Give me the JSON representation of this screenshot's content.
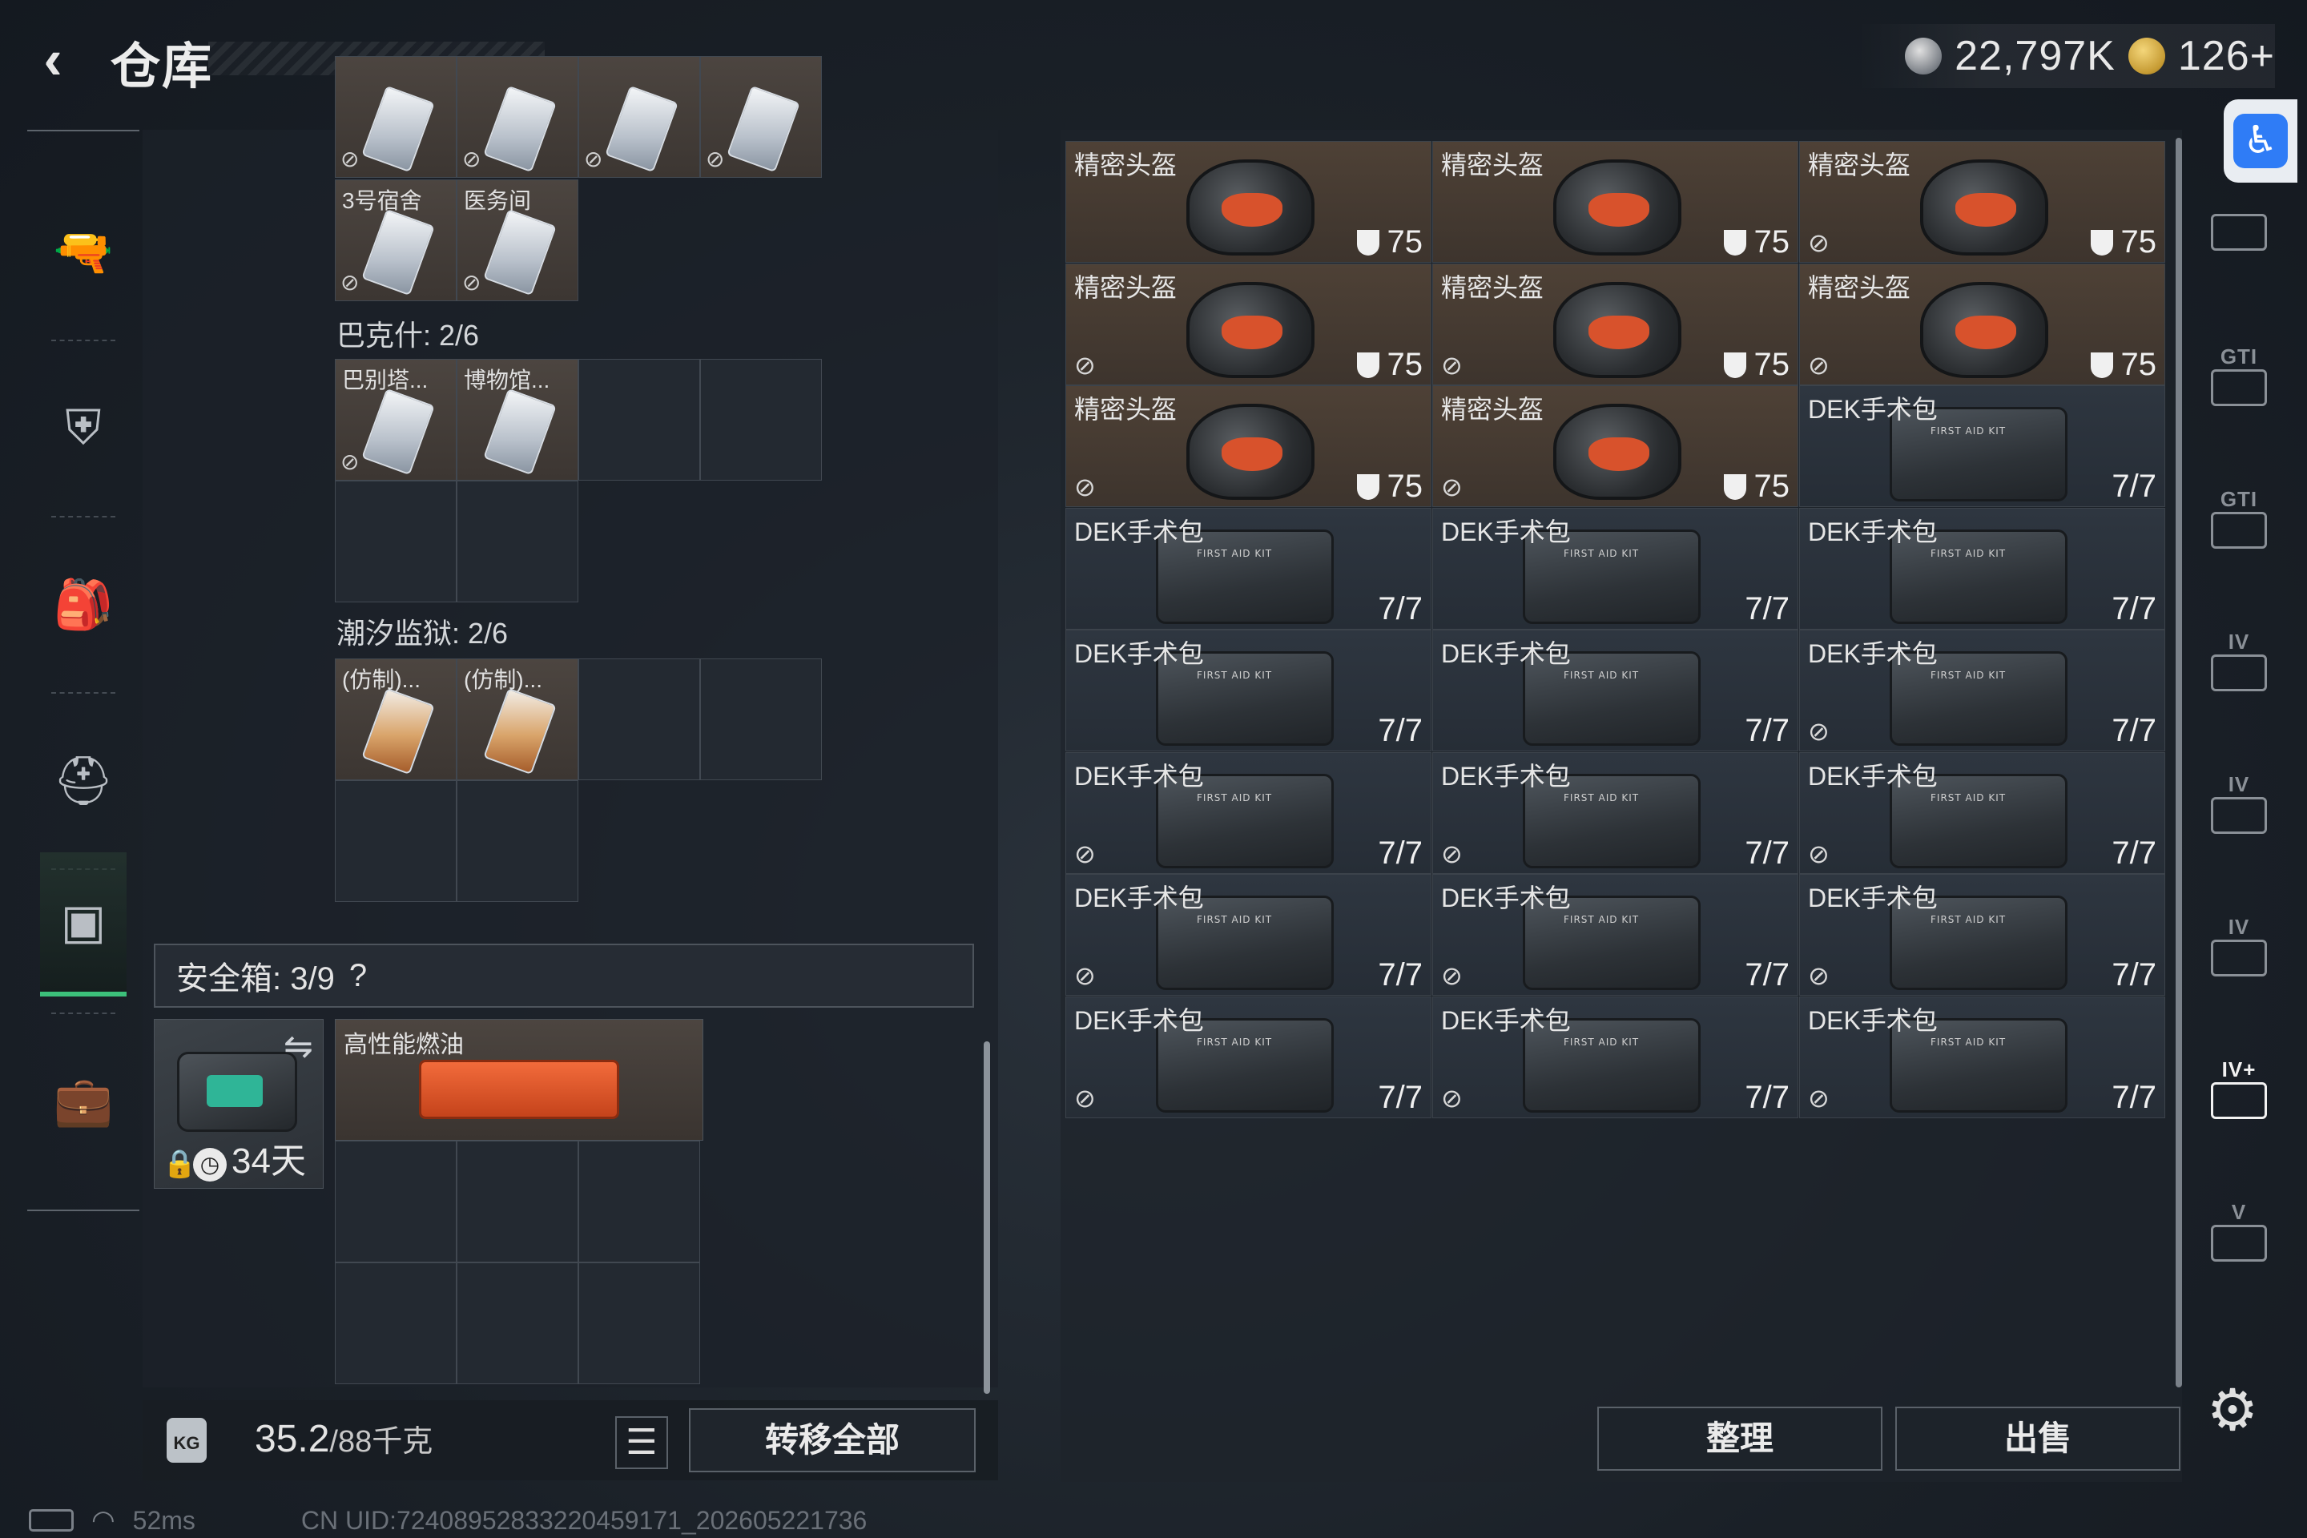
{
  "header": {
    "title": "仓库",
    "silver": "22,797K",
    "gold": "126+"
  },
  "leftnav": {
    "items": [
      {
        "icon": "gun-icon",
        "glyph": "🔫"
      },
      {
        "icon": "armor-vest-icon",
        "glyph": "⛨"
      },
      {
        "icon": "backpack-icon",
        "glyph": "🎒"
      },
      {
        "icon": "chest-rig-icon",
        "glyph": "⛑"
      },
      {
        "icon": "container-icon",
        "glyph": "▣"
      },
      {
        "icon": "briefcase-icon",
        "glyph": "💼"
      }
    ]
  },
  "left_inventory": {
    "key_row1": [
      "3号宿舍",
      "医务间"
    ],
    "section1_label": "巴克什: 2/6",
    "key_row2": [
      "巴别塔...",
      "博物馆..."
    ],
    "section2_label": "潮汐监狱: 2/6",
    "key_row3": [
      "(仿制)...",
      "(仿制)..."
    ]
  },
  "safebox": {
    "label": "安全箱: 3/9",
    "help": "?",
    "days": "34天",
    "item_name": "高性能燃油"
  },
  "weight": {
    "current": "35.2",
    "max": "/88千克",
    "list_icon": "☰",
    "transfer_label": "转移全部",
    "lock_text": "KG"
  },
  "stash": {
    "items": [
      {
        "name": "精密头盔",
        "kind": "helmet",
        "value": "75",
        "nosell": false
      },
      {
        "name": "精密头盔",
        "kind": "helmet",
        "value": "75",
        "nosell": false
      },
      {
        "name": "精密头盔",
        "kind": "helmet",
        "value": "75",
        "nosell": true
      },
      {
        "name": "精密头盔",
        "kind": "helmet",
        "value": "75",
        "nosell": true
      },
      {
        "name": "精密头盔",
        "kind": "helmet",
        "value": "75",
        "nosell": true
      },
      {
        "name": "精密头盔",
        "kind": "helmet",
        "value": "75",
        "nosell": true
      },
      {
        "name": "精密头盔",
        "kind": "helmet",
        "value": "75",
        "nosell": true
      },
      {
        "name": "精密头盔",
        "kind": "helmet",
        "value": "75",
        "nosell": true
      },
      {
        "name": "DEK手术包",
        "kind": "kit",
        "value": "7/7",
        "nosell": false
      },
      {
        "name": "DEK手术包",
        "kind": "kit",
        "value": "7/7",
        "nosell": false
      },
      {
        "name": "DEK手术包",
        "kind": "kit",
        "value": "7/7",
        "nosell": false
      },
      {
        "name": "DEK手术包",
        "kind": "kit",
        "value": "7/7",
        "nosell": false
      },
      {
        "name": "DEK手术包",
        "kind": "kit",
        "value": "7/7",
        "nosell": false
      },
      {
        "name": "DEK手术包",
        "kind": "kit",
        "value": "7/7",
        "nosell": false
      },
      {
        "name": "DEK手术包",
        "kind": "kit",
        "value": "7/7",
        "nosell": true
      },
      {
        "name": "DEK手术包",
        "kind": "kit",
        "value": "7/7",
        "nosell": true
      },
      {
        "name": "DEK手术包",
        "kind": "kit",
        "value": "7/7",
        "nosell": true
      },
      {
        "name": "DEK手术包",
        "kind": "kit",
        "value": "7/7",
        "nosell": true
      },
      {
        "name": "DEK手术包",
        "kind": "kit",
        "value": "7/7",
        "nosell": true
      },
      {
        "name": "DEK手术包",
        "kind": "kit",
        "value": "7/7",
        "nosell": true
      },
      {
        "name": "DEK手术包",
        "kind": "kit",
        "value": "7/7",
        "nosell": true
      },
      {
        "name": "DEK手术包",
        "kind": "kit",
        "value": "7/7",
        "nosell": true
      },
      {
        "name": "DEK手术包",
        "kind": "kit",
        "value": "7/7",
        "nosell": true
      },
      {
        "name": "DEK手术包",
        "kind": "kit",
        "value": "7/7",
        "nosell": true
      }
    ],
    "sort_label": "整理",
    "sell_label": "出售"
  },
  "rightnav": {
    "items": [
      {
        "tag": "",
        "icon": "stash-home-icon",
        "active": false
      },
      {
        "tag": "GTI",
        "icon": "stash-tab-gti-1-icon",
        "active": false
      },
      {
        "tag": "GTI",
        "icon": "stash-tab-gti-2-icon",
        "active": false
      },
      {
        "tag": "IV",
        "icon": "stash-tab-iv-1-icon",
        "active": false
      },
      {
        "tag": "IV",
        "icon": "stash-tab-iv-2-icon",
        "active": false
      },
      {
        "tag": "IV",
        "icon": "stash-tab-iv-3-icon",
        "active": false
      },
      {
        "tag": "IV+",
        "icon": "stash-tab-iv-add-icon",
        "active": true
      },
      {
        "tag": "V",
        "icon": "stash-tab-v-icon",
        "active": false
      }
    ]
  },
  "status": {
    "ping": "52ms",
    "uid": "CN UID:7240895283322045917‌1_202605221736"
  },
  "colors": {
    "helmet_bg": "#4e4136",
    "kit_bg": "#2e3640",
    "active_nav_accent": "#3cc07a",
    "a11y_blue": "#2f7cf6"
  }
}
